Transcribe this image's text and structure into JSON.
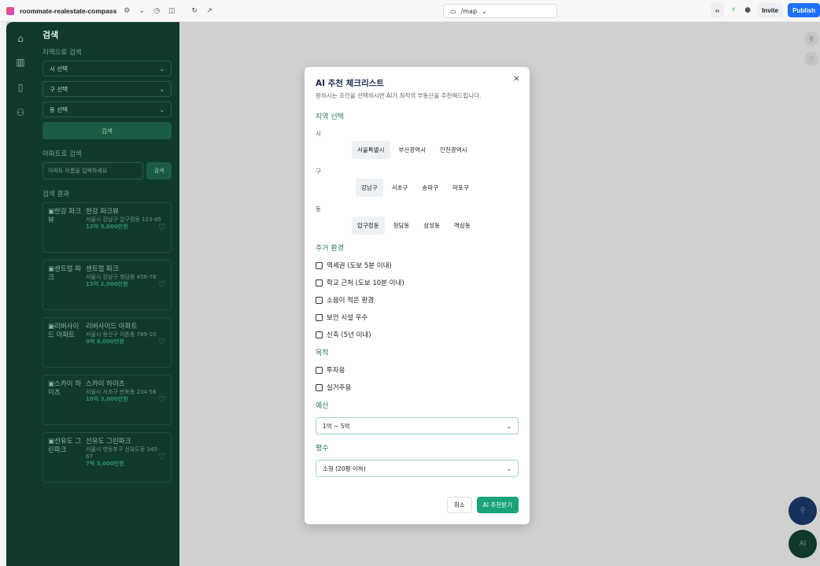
{
  "browser": {
    "project_name": "roommate-realestate-compass",
    "url": "/map",
    "invite_label": "Invite",
    "publish_label": "Publish"
  },
  "sidebar": {
    "title": "검색",
    "region_label": "지역으로 검색",
    "selects": [
      "시 선택",
      "구 선택",
      "동 선택"
    ],
    "search_button": "검색",
    "apt_label": "아파트로 검색",
    "apt_placeholder": "아파트 이름을 입력하세요",
    "apt_button": "검색",
    "results_label": "검색 결과",
    "results": [
      {
        "thumb": "한강 파크뷰",
        "name": "한강 파크뷰",
        "addr": "서울시 강남구 압구정동 123-45",
        "price": "12억 5,000만원"
      },
      {
        "thumb": "센트럴 파크",
        "name": "센트럴 파크",
        "addr": "서울시 강남구 청담동 456-78",
        "price": "15억 2,000만원"
      },
      {
        "thumb": "리버사이드 아파트",
        "name": "리버사이드 아파트",
        "addr": "서울시 용산구 이촌동 789-10",
        "price": "9억 8,000만원"
      },
      {
        "thumb": "스카이 하이츠",
        "name": "스카이 하이츠",
        "addr": "서울시 서초구 반포동 234-56",
        "price": "10억 3,000만원"
      },
      {
        "thumb": "선유도 그린파크",
        "name": "선유도 그린파크",
        "addr": "서울시 영등포구 선유도동 345-67",
        "price": "7억 5,000만원"
      }
    ]
  },
  "fab": {
    "ai_label": "AI"
  },
  "modal": {
    "title": "AI 추천 체크리스트",
    "subtitle": "원하시는 조건을 선택하시면 AI가 최적의 부동산을 추천해드립니다.",
    "region_section": "지역 선택",
    "si_label": "시",
    "si_options": [
      "서울특별시",
      "부산광역시",
      "인천광역시"
    ],
    "gu_label": "구",
    "gu_options": [
      "강남구",
      "서초구",
      "송파구",
      "마포구"
    ],
    "dong_label": "동",
    "dong_options": [
      "압구정동",
      "청담동",
      "삼성동",
      "역삼동"
    ],
    "env_section": "주거 환경",
    "env_options": [
      "역세권 (도보 5분 이내)",
      "학교 근처 (도보 10분 이내)",
      "소음이 적은 환경",
      "보안 시설 우수",
      "신축 (5년 이내)"
    ],
    "purpose_section": "목적",
    "purpose_options": [
      "투자용",
      "실거주용"
    ],
    "budget_section": "예산",
    "budget_value": "1억 ~ 5억",
    "size_section": "평수",
    "size_value": "소형 (20평 이하)",
    "cancel_label": "취소",
    "submit_label": "AI 추천받기"
  }
}
